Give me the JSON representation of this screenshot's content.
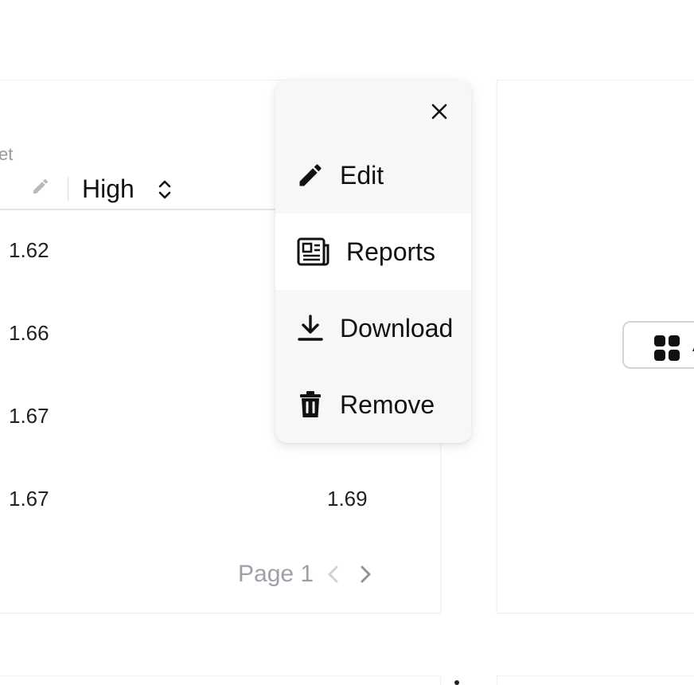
{
  "table": {
    "subtitle_fragment": "et",
    "column_high": "High",
    "rows": [
      {
        "open": "1.62",
        "high": ""
      },
      {
        "open": "1.66",
        "high": ""
      },
      {
        "open": "1.67",
        "high": ""
      },
      {
        "open": "1.67",
        "high": "1.69"
      }
    ]
  },
  "pagination": {
    "label": "Page 1"
  },
  "menu": {
    "items": [
      {
        "label": "Edit",
        "icon": "pencil-icon"
      },
      {
        "label": "Reports",
        "icon": "newspaper-icon"
      },
      {
        "label": "Download",
        "icon": "download-icon"
      },
      {
        "label": "Remove",
        "icon": "trash-icon"
      }
    ]
  },
  "right_card": {
    "apps_button_label": "A"
  }
}
